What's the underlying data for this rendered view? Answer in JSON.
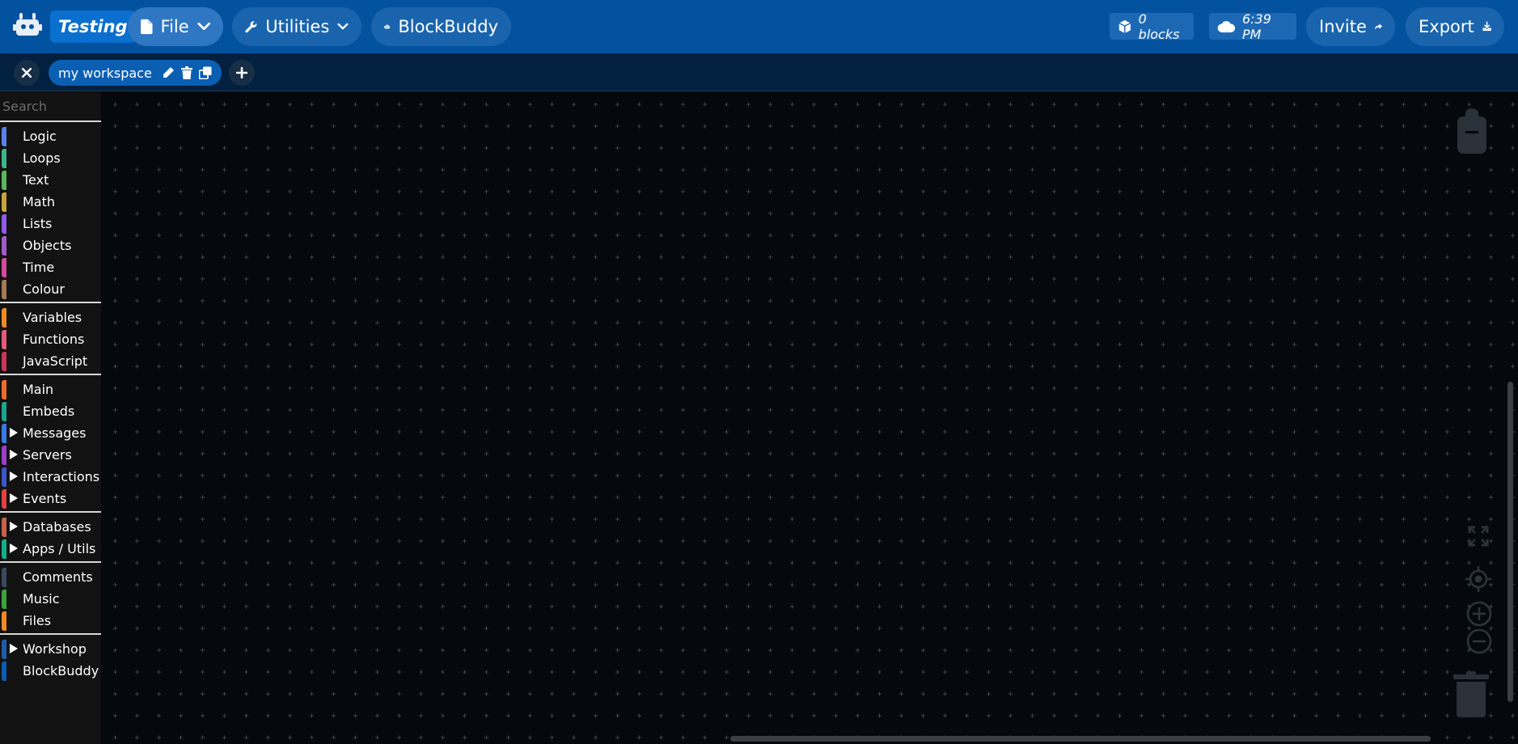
{
  "topbar": {
    "logo_icon": "robot-logo",
    "brand": "Testing",
    "menus": [
      {
        "label": "File",
        "icon": "file-icon"
      },
      {
        "label": "Utilities",
        "icon": "wrench-icon"
      },
      {
        "label": "BlockBuddy",
        "icon": "robot-icon"
      }
    ],
    "block_count": "0 blocks",
    "save_time": "6:39 PM",
    "invite_label": "Invite",
    "export_label": "Export"
  },
  "tabbar": {
    "tabs": [
      {
        "label": "my workspace"
      }
    ]
  },
  "sidebar": {
    "search_placeholder": "Search",
    "groups": [
      [
        {
          "label": "Logic",
          "color": "#5b80e8",
          "expandable": false
        },
        {
          "label": "Loops",
          "color": "#3eb38a",
          "expandable": false
        },
        {
          "label": "Text",
          "color": "#5bb65b",
          "expandable": false
        },
        {
          "label": "Math",
          "color": "#c9a33c",
          "expandable": false
        },
        {
          "label": "Lists",
          "color": "#8e5be6",
          "expandable": false
        },
        {
          "label": "Objects",
          "color": "#a15bc6",
          "expandable": false
        },
        {
          "label": "Time",
          "color": "#d34b9e",
          "expandable": false
        },
        {
          "label": "Colour",
          "color": "#a57a54",
          "expandable": false
        }
      ],
      [
        {
          "label": "Variables",
          "color": "#f08a24",
          "expandable": false
        },
        {
          "label": "Functions",
          "color": "#e25b7a",
          "expandable": false
        },
        {
          "label": "JavaScript",
          "color": "#c8365b",
          "expandable": false
        }
      ],
      [
        {
          "label": "Main",
          "color": "#f06b2a",
          "expandable": false
        },
        {
          "label": "Embeds",
          "color": "#1ca48f",
          "expandable": false
        },
        {
          "label": "Messages",
          "color": "#3a7ae8",
          "expandable": true
        },
        {
          "label": "Servers",
          "color": "#9b3fc7",
          "expandable": true
        },
        {
          "label": "Interactions",
          "color": "#3c56c8",
          "expandable": true
        },
        {
          "label": "Events",
          "color": "#e04242",
          "expandable": true
        }
      ],
      [
        {
          "label": "Databases",
          "color": "#c7614a",
          "expandable": true
        },
        {
          "label": "Apps / Utils",
          "color": "#12b08a",
          "expandable": true
        }
      ],
      [
        {
          "label": "Comments",
          "color": "#3a4a5e",
          "expandable": false
        },
        {
          "label": "Music",
          "color": "#3aa43a",
          "expandable": false
        },
        {
          "label": "Files",
          "color": "#f08a24",
          "expandable": false
        }
      ],
      [
        {
          "label": "Workshop",
          "color": "#1f5ba8",
          "expandable": true
        },
        {
          "label": "BlockBuddy",
          "color": "#0d5cb4",
          "expandable": false
        }
      ]
    ]
  },
  "workspace": {
    "controls": [
      "backpack-icon",
      "fullscreen-icon",
      "recenter-icon",
      "zoom-in-icon",
      "zoom-out-icon",
      "trash-icon"
    ]
  }
}
